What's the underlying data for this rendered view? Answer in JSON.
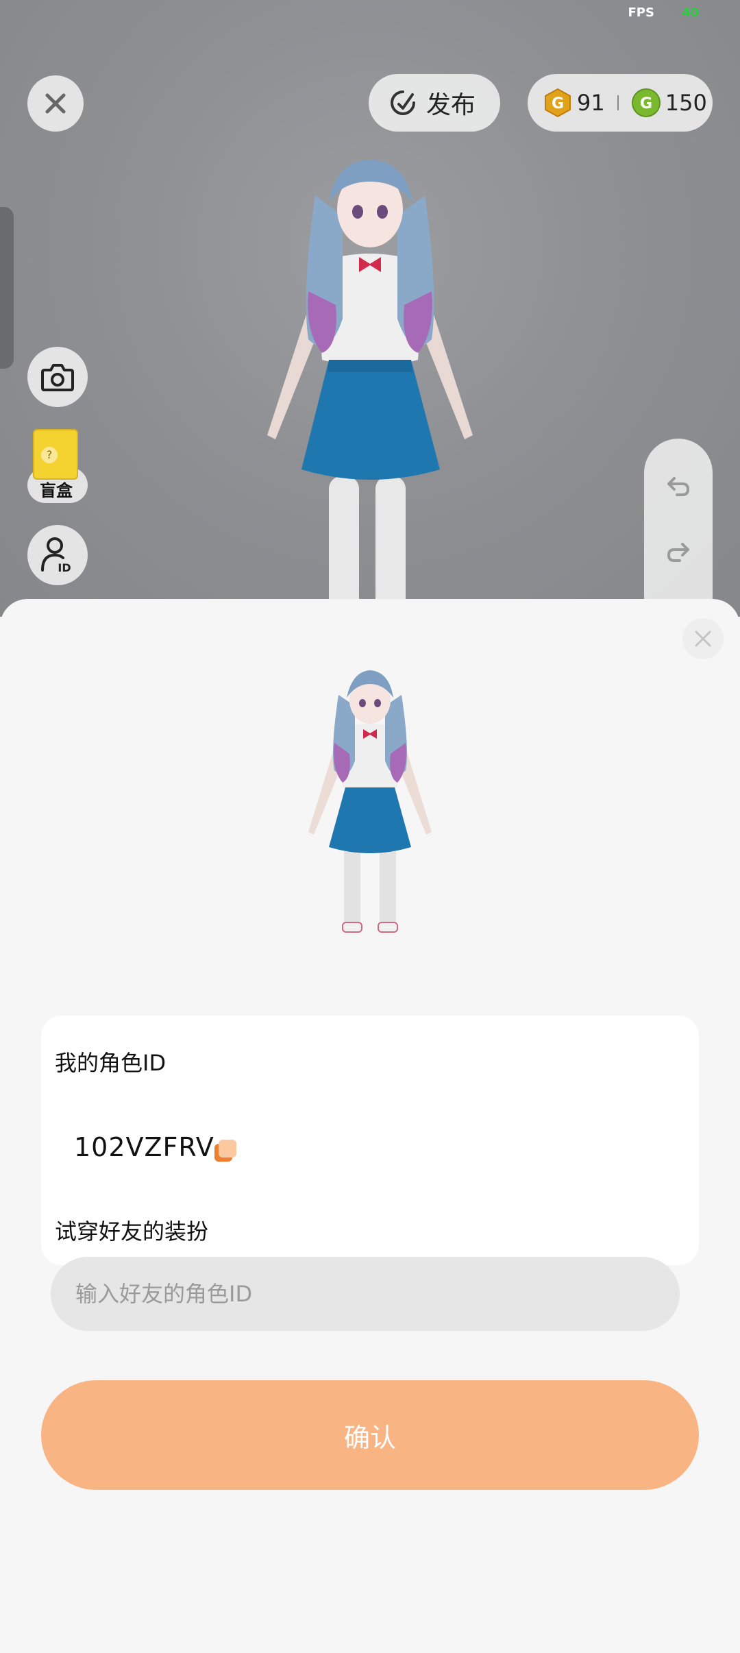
{
  "status": {
    "fps_label": "FPS",
    "fps_value": "40"
  },
  "header": {
    "publish_label": "发布",
    "gold_coins": "91",
    "green_coins": "150"
  },
  "left_tools": {
    "blind_box_label": "盲盒"
  },
  "dialog": {
    "my_id_label": "我的角色ID",
    "my_id_value": "102VZFRV",
    "tryon_label": "试穿好友的装扮",
    "friend_id_placeholder": "输入好友的角色ID",
    "confirm_label": "确认"
  },
  "colors": {
    "accent_orange": "#f8b583",
    "gold_coin": "#e0a21a",
    "green_coin": "#7ab82e",
    "fps_value": "#2ecc40"
  }
}
